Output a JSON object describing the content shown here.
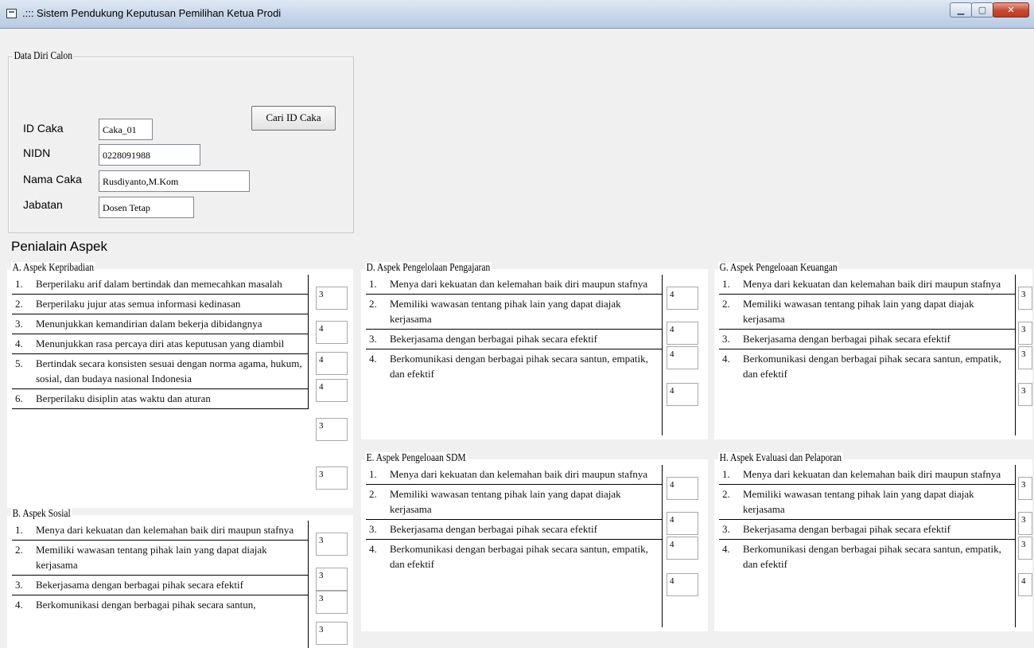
{
  "window": {
    "title": ".::: Sistem Pendukung Keputusan Pemilihan Ketua Prodi"
  },
  "data_diri": {
    "legend": "Data Diri Calon",
    "id_label": "ID Caka",
    "id_value": "Caka_01",
    "nidn_label": "NIDN",
    "nidn_value": "0228091988",
    "nama_label": "Nama Caka",
    "nama_value": "Rusdiyanto,M.Kom",
    "jabatan_label": "Jabatan",
    "jabatan_value": "Dosen Tetap",
    "cari_button": "Cari ID Caka"
  },
  "section_title": "Penialain Aspek",
  "aspects": [
    {
      "legend": "A. Aspek Kepribadian",
      "items": [
        {
          "num": "1.",
          "text": "Berperilaku arif dalam bertindak  dan memecahkan masalah"
        },
        {
          "num": "2.",
          "text": "Berperilaku jujur atas semua informasi kedinasan"
        },
        {
          "num": "3.",
          "text": "Menunjukkan kemandirian dalam bekerja dibidangnya"
        },
        {
          "num": "4.",
          "text": "Menunjukkan rasa percaya diri atas keputusan yang diambil"
        },
        {
          "num": "5.",
          "text": "Bertindak secara konsisten sesuai dengan norma agama, hukum, sosial, dan budaya nasional Indonesia"
        },
        {
          "num": "6.",
          "text": "Berperilaku  disiplin  atas waktu dan aturan"
        }
      ],
      "values": [
        "3",
        "4",
        "4",
        "4",
        "3",
        "3"
      ]
    },
    {
      "legend": "B. Aspek Sosial",
      "items": [
        {
          "num": "1.",
          "text": "Menya dari kekuatan dan kelemahan baik diri maupun stafnya"
        },
        {
          "num": "2.",
          "text": "Memiliki wawasan tentang pihak lain yang dapat diajak kerjasama"
        },
        {
          "num": "3.",
          "text": "Bekerjasama dengan berbagai pihak secara efektif"
        },
        {
          "num": "4.",
          "text": "Berkomunikasi dengan berbagai pihak secara santun,"
        }
      ],
      "values": [
        "3",
        "3",
        "3",
        "3"
      ]
    },
    {
      "legend": "D. Aspek Pengelolaan Pengajaran",
      "items": [
        {
          "num": "1.",
          "text": "Menya dari kekuatan dan kelemahan baik diri maupun stafnya"
        },
        {
          "num": "2.",
          "text": "Memiliki wawasan tentang pihak lain yang dapat diajak kerjasama"
        },
        {
          "num": "3.",
          "text": "Bekerjasama dengan berbagai pihak secara efektif"
        },
        {
          "num": "4.",
          "text": "Berkomunikasi dengan berbagai pihak secara santun, empatik, dan efektif"
        }
      ],
      "values": [
        "4",
        "4",
        "4",
        "4"
      ]
    },
    {
      "legend": "E. Aspek Pengeloaan SDM",
      "items": [
        {
          "num": "1.",
          "text": "Menya dari kekuatan dan kelemahan baik diri maupun stafnya"
        },
        {
          "num": "2.",
          "text": "Memiliki wawasan tentang pihak lain yang dapat diajak kerjasama"
        },
        {
          "num": "3.",
          "text": "Bekerjasama dengan berbagai pihak secara efektif"
        },
        {
          "num": "4.",
          "text": "Berkomunikasi dengan berbagai pihak secara santun, empatik, dan efektif"
        }
      ],
      "values": [
        "4",
        "4",
        "4",
        "4"
      ]
    },
    {
      "legend": "G. Aspek Pengeloaan Keuangan",
      "items": [
        {
          "num": "1.",
          "text": "Menya dari kekuatan dan kelemahan baik diri maupun stafnya"
        },
        {
          "num": "2.",
          "text": "Memiliki wawasan tentang pihak lain yang dapat diajak kerjasama"
        },
        {
          "num": "3.",
          "text": "Bekerjasama dengan berbagai pihak secara efektif"
        },
        {
          "num": "4.",
          "text": "Berkomunikasi dengan berbagai pihak secara santun, empatik, dan efektif"
        }
      ],
      "values": [
        "3",
        "3",
        "3",
        "3"
      ]
    },
    {
      "legend": "H. Aspek Evaluasi dan Pelaporan",
      "items": [
        {
          "num": "1.",
          "text": "Menya dari kekuatan dan kelemahan baik diri maupun stafnya"
        },
        {
          "num": "2.",
          "text": "Memiliki wawasan tentang pihak lain yang dapat diajak kerjasama"
        },
        {
          "num": "3.",
          "text": "Bekerjasama dengan berbagai pihak secara efektif"
        },
        {
          "num": "4.",
          "text": "Berkomunikasi dengan berbagai pihak secara santun, empatik, dan efektif"
        }
      ],
      "values": [
        "3",
        "3",
        "3",
        "4"
      ]
    }
  ]
}
